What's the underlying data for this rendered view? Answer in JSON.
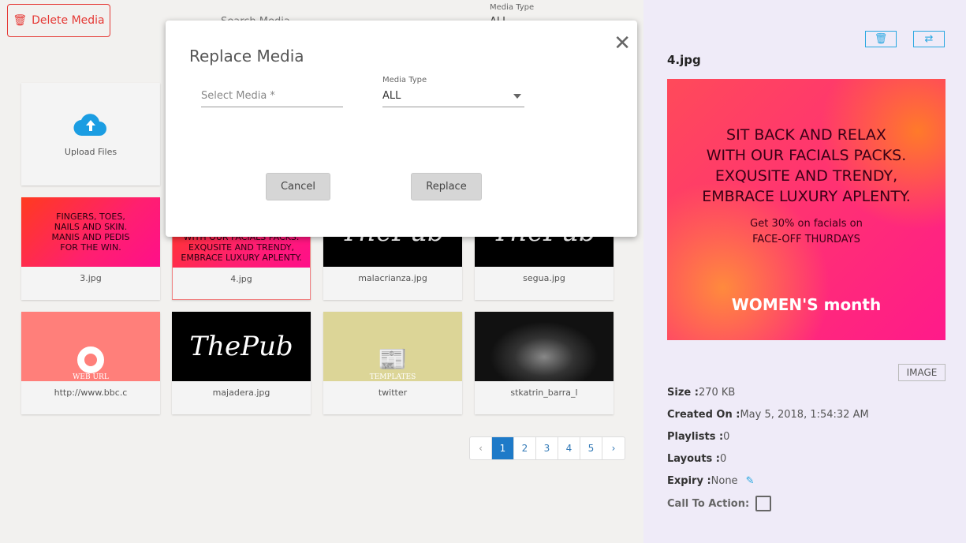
{
  "toolbar": {
    "delete_label": "Delete Media",
    "search_label": "Search Media",
    "media_type_label": "Media Type",
    "media_type_value": "ALL"
  },
  "upload": {
    "label": "Upload Files"
  },
  "media": [
    {
      "name": "3.jpg",
      "caption": "FINGERS, TOES,\nNAILS AND SKIN.\nMANIS AND PEDIS\nFOR THE WIN."
    },
    {
      "name": "4.jpg",
      "caption": "WITH OUR FACIALS PACKS.\nEXQUSITE AND TRENDY,\nEMBRACE LUXURY APLENTY."
    },
    {
      "name": "malacrianza.jpg",
      "caption": "ThePub"
    },
    {
      "name": "segua.jpg",
      "caption": "ThePub"
    },
    {
      "name": "http://www.bbc.c",
      "caption": "WEB URL"
    },
    {
      "name": "majadera.jpg",
      "caption": "ThePub"
    },
    {
      "name": "twitter",
      "caption": "TEMPLATES"
    },
    {
      "name": "stkatrin_barra_l",
      "caption": ""
    }
  ],
  "pagination": {
    "prev": "‹",
    "pages": [
      "1",
      "2",
      "3",
      "4",
      "5"
    ],
    "next": "›",
    "current": "1"
  },
  "dialog": {
    "title": "Replace Media",
    "close": "✕",
    "select_placeholder": "Select Media *",
    "media_type_label": "Media Type",
    "media_type_value": "ALL",
    "cancel": "Cancel",
    "replace": "Replace"
  },
  "details": {
    "filename": "4.jpg",
    "preview_text": "SIT BACK AND RELAX\nWITH OUR FACIALS PACKS.\nEXQUSITE AND TRENDY,\nEMBRACE LUXURY APLENTY.",
    "preview_offer": "Get 30% on facials on\nFACE-OFF THURDAYS",
    "preview_logo": "WOMEN'S month",
    "type_badge": "IMAGE",
    "size_label": "Size :",
    "size": "270 KB",
    "created_label": "Created On :",
    "created": "May 5, 2018, 1:54:32 AM",
    "playlists_label": "Playlists :",
    "playlists": "0",
    "layouts_label": "Layouts :",
    "layouts": "0",
    "expiry_label": "Expiry :",
    "expiry": "None",
    "cta_label": "Call To Action:",
    "cta_checked": false
  },
  "colors": {
    "accent": "#29a7e1",
    "danger": "#e53935",
    "active_page": "#1e7ac8",
    "panel": "#efebf8"
  }
}
